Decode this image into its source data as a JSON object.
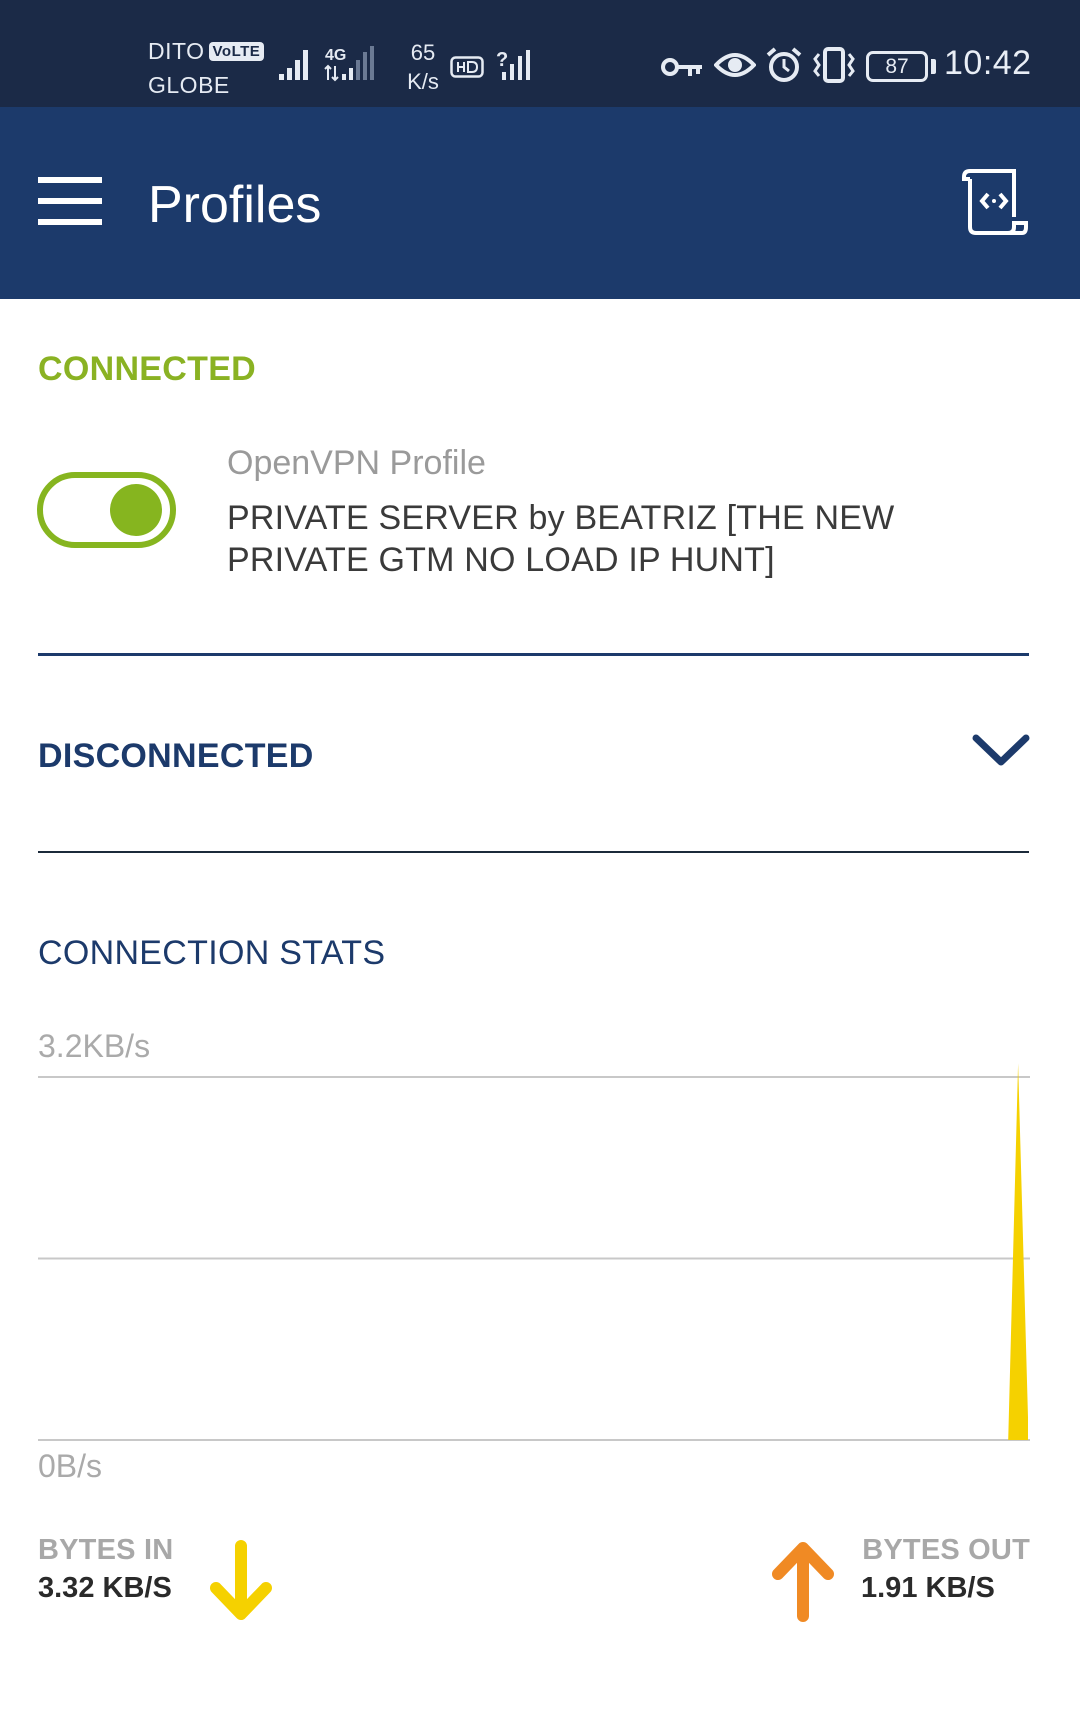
{
  "status_bar": {
    "carrier_1": "DITO",
    "volte_badge": "VoLTE",
    "carrier_2": "GLOBE",
    "network_type": "4G",
    "net_speed_value": "65",
    "net_speed_unit": "K/s",
    "battery": "87",
    "time": "10:42",
    "icons": [
      "signal-icon",
      "signal-4g-icon",
      "hd-icon",
      "wifi-question-icon",
      "key-icon",
      "eye-icon",
      "alarm-icon",
      "vibrate-icon",
      "battery-icon"
    ]
  },
  "app_bar": {
    "title": "Profiles",
    "icons": [
      "menu-icon",
      "import-file-icon"
    ]
  },
  "connected_section": {
    "heading": "CONNECTED",
    "toggle_on": true,
    "profile_type": "OpenVPN Profile",
    "profile_name": "PRIVATE SERVER by BEATRIZ [THE NEW PRIVATE GTM NO LOAD IP HUNT]"
  },
  "disconnected_section": {
    "heading": "DISCONNECTED",
    "expanded": false
  },
  "stats": {
    "heading": "CONNECTION STATS",
    "bytes_in_label": "BYTES IN",
    "bytes_in_value": "3.32 KB/S",
    "bytes_out_label": "BYTES OUT",
    "bytes_out_value": "1.91 KB/S"
  },
  "colors": {
    "status_bar": "#1b2a47",
    "app_bar": "#1c3a6b",
    "connected_green": "#8ab223",
    "navy": "#1c3a6b",
    "bytes_in_yellow": "#f5d100",
    "bytes_out_orange": "#f08a24"
  },
  "chart_data": {
    "type": "area",
    "y_max_label": "3.2KB/s",
    "y_min_label": "0B/s",
    "ylim": [
      0,
      3.2
    ],
    "y_unit": "KB/s",
    "grid": true,
    "x": [
      0,
      1,
      2,
      3,
      4,
      5,
      6,
      7,
      8,
      9,
      10,
      11,
      12,
      13,
      14,
      15,
      16,
      17,
      18,
      19,
      20,
      21,
      22,
      23,
      24,
      25,
      26,
      27,
      28,
      29,
      30,
      31,
      32,
      33,
      34,
      35,
      36,
      37,
      38,
      39,
      40,
      41,
      42,
      43,
      44,
      45,
      46,
      47,
      48,
      49,
      50,
      51,
      52,
      53,
      54,
      55,
      56,
      57,
      58,
      59,
      60,
      61,
      62,
      63,
      64,
      65,
      66,
      67,
      68,
      69,
      70,
      71,
      72,
      73,
      74,
      75,
      76,
      77,
      78,
      79,
      80,
      81,
      82,
      83,
      84,
      85,
      86,
      87,
      88,
      89,
      90,
      91,
      92,
      93,
      94,
      95,
      96,
      97,
      98,
      99,
      100
    ],
    "series": [
      {
        "values": [
          0,
          0,
          0,
          0,
          0,
          0,
          0,
          0,
          0,
          0,
          0,
          0,
          0,
          0,
          0,
          0,
          0,
          0,
          0,
          0,
          0,
          0,
          0,
          0,
          0,
          0,
          0,
          0,
          0,
          0,
          0,
          0,
          0,
          0,
          0,
          0,
          0,
          0,
          0,
          0,
          0,
          0,
          0,
          0,
          0,
          0,
          0,
          0,
          0,
          0,
          0,
          0,
          0,
          0,
          0,
          0,
          0,
          0,
          0,
          0,
          0,
          0,
          0,
          0,
          0,
          0,
          0,
          0,
          0,
          0,
          0,
          0,
          0,
          0,
          0,
          0,
          0,
          0,
          0,
          0,
          0,
          0,
          0,
          0,
          0,
          0,
          0,
          0,
          0,
          0,
          0,
          0,
          0,
          0,
          0,
          0,
          0,
          0,
          0,
          3.32,
          0.2
        ],
        "color": "#f5d100"
      }
    ]
  }
}
